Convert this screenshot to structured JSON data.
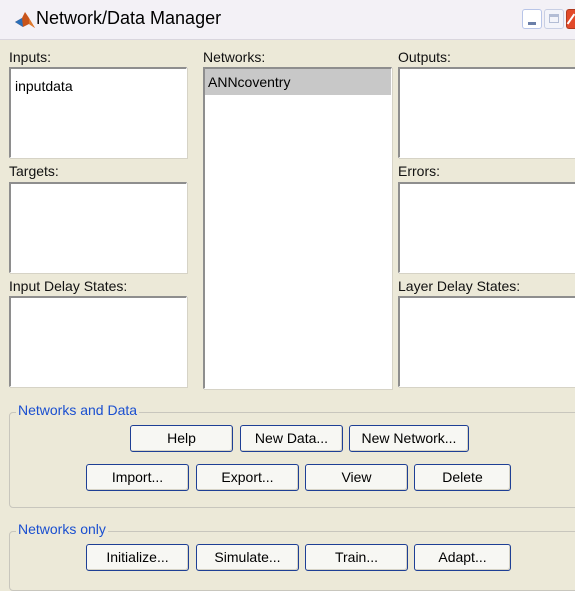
{
  "window": {
    "title": "Network/Data Manager"
  },
  "panels": {
    "inputs": {
      "label": "Inputs:",
      "items": [
        "inputdata"
      ]
    },
    "networks": {
      "label": "Networks:",
      "items": [
        "ANNcoventry"
      ],
      "selected": "ANNcoventry"
    },
    "outputs": {
      "label": "Outputs:",
      "items": []
    },
    "targets": {
      "label": "Targets:",
      "items": []
    },
    "errors": {
      "label": "Errors:",
      "items": []
    },
    "input_delay_states": {
      "label": "Input Delay States:",
      "items": []
    },
    "layer_delay_states": {
      "label": "Layer Delay States:",
      "items": []
    }
  },
  "networks_and_data": {
    "title": "Networks and Data",
    "buttons": {
      "help": "Help",
      "new_data": "New Data...",
      "new_network": "New Network...",
      "import": "Import...",
      "export": "Export...",
      "view": "View",
      "delete": "Delete"
    }
  },
  "networks_only": {
    "title": "Networks only",
    "buttons": {
      "initialize": "Initialize...",
      "simulate": "Simulate...",
      "train": "Train...",
      "adapt": "Adapt..."
    }
  }
}
